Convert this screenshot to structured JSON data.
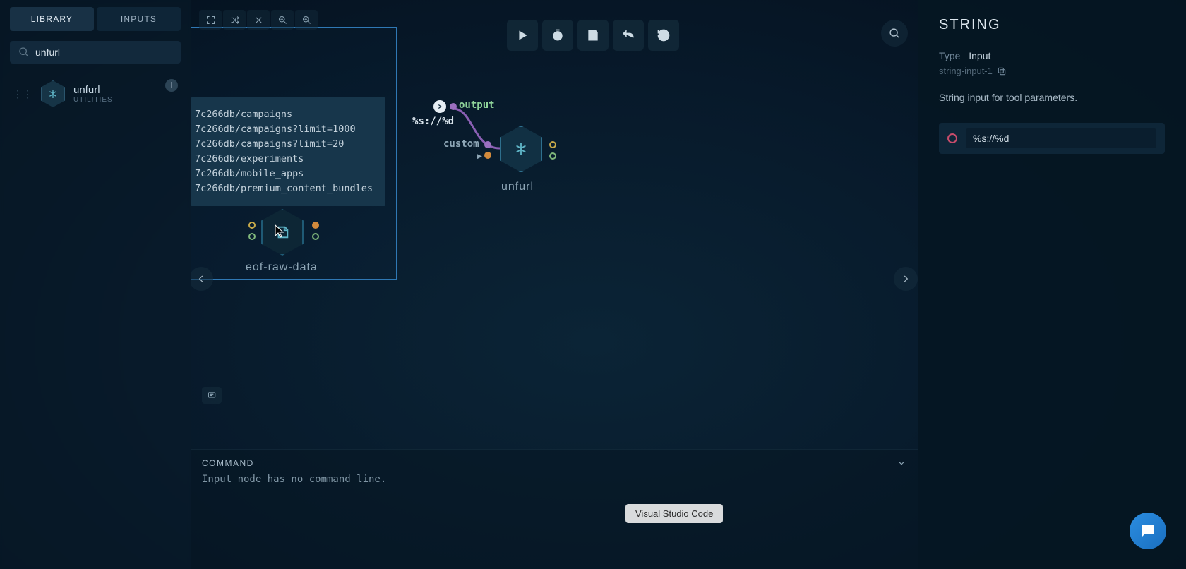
{
  "sidebar": {
    "tabs": {
      "library": "LIBRARY",
      "inputs": "INPUTS"
    },
    "search_value": "unfurl",
    "item": {
      "name": "unfurl",
      "category": "UTILITIES"
    }
  },
  "canvas_toolbar_icons": [
    "fullscreen",
    "shuffle",
    "close",
    "zoom-out",
    "zoom-in"
  ],
  "url_list": [
    "7c266db/campaigns",
    "7c266db/campaigns?limit=1000",
    "7c266db/campaigns?limit=20",
    "7c266db/experiments",
    "7c266db/mobile_apps",
    "7c266db/premium_content_bundles"
  ],
  "canvas_labels": {
    "format": "%s://%d",
    "output": "output",
    "custom": "custom"
  },
  "nodes": {
    "unfurl": {
      "label": "unfurl"
    },
    "eof": {
      "label": "eof-raw-data"
    }
  },
  "command": {
    "title": "COMMAND",
    "body": "Input node has no command line."
  },
  "inspector": {
    "title": "STRING",
    "type_label": "Type",
    "type_value": "Input",
    "id": "string-input-1",
    "description": "String input for tool parameters.",
    "value": "%s://%d"
  },
  "dock_tooltip": "Visual Studio Code"
}
